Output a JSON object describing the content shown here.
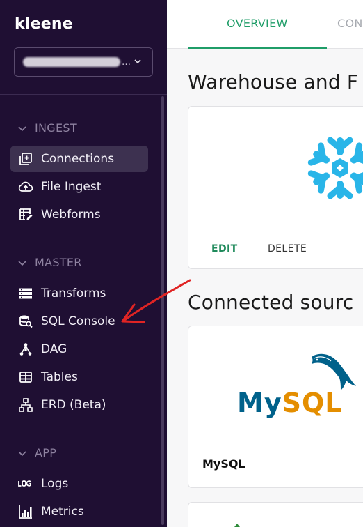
{
  "sidebar": {
    "logo": "kleene",
    "account_name": "…",
    "sections": [
      {
        "title": "INGEST",
        "items": [
          {
            "label": "Connections",
            "icon": "connections-icon",
            "active": true
          },
          {
            "label": "File Ingest",
            "icon": "cloud-upload-icon",
            "active": false
          },
          {
            "label": "Webforms",
            "icon": "webform-icon",
            "active": false
          }
        ]
      },
      {
        "title": "MASTER",
        "items": [
          {
            "label": "Transforms",
            "icon": "transforms-icon",
            "active": false
          },
          {
            "label": "SQL Console",
            "icon": "sql-console-icon",
            "active": false
          },
          {
            "label": "DAG",
            "icon": "dag-icon",
            "active": false
          },
          {
            "label": "Tables",
            "icon": "tables-icon",
            "active": false
          },
          {
            "label": "ERD (Beta)",
            "icon": "erd-icon",
            "active": false
          }
        ]
      },
      {
        "title": "APP",
        "items": [
          {
            "label": "Logs",
            "icon": "logs-icon",
            "active": false
          },
          {
            "label": "Metrics",
            "icon": "metrics-icon",
            "active": false
          }
        ]
      }
    ]
  },
  "tabs": [
    {
      "label": "OVERVIEW",
      "active": true
    },
    {
      "label": "CON",
      "active": false
    }
  ],
  "main": {
    "warehouse_heading": "Warehouse and F",
    "warehouse_card": {
      "logo": "snowflake-icon",
      "edit_label": "EDIT",
      "delete_label": "DELETE"
    },
    "connected_heading": "Connected sourc",
    "source_card": {
      "logo_my": "My",
      "logo_sql": "SQL",
      "label": "MySQL"
    }
  },
  "colors": {
    "sidebar_bg": "#1f0f33",
    "accent_green": "#1f9d68",
    "snowflake_blue": "#29b5e8",
    "annotation_red": "#e02424"
  }
}
